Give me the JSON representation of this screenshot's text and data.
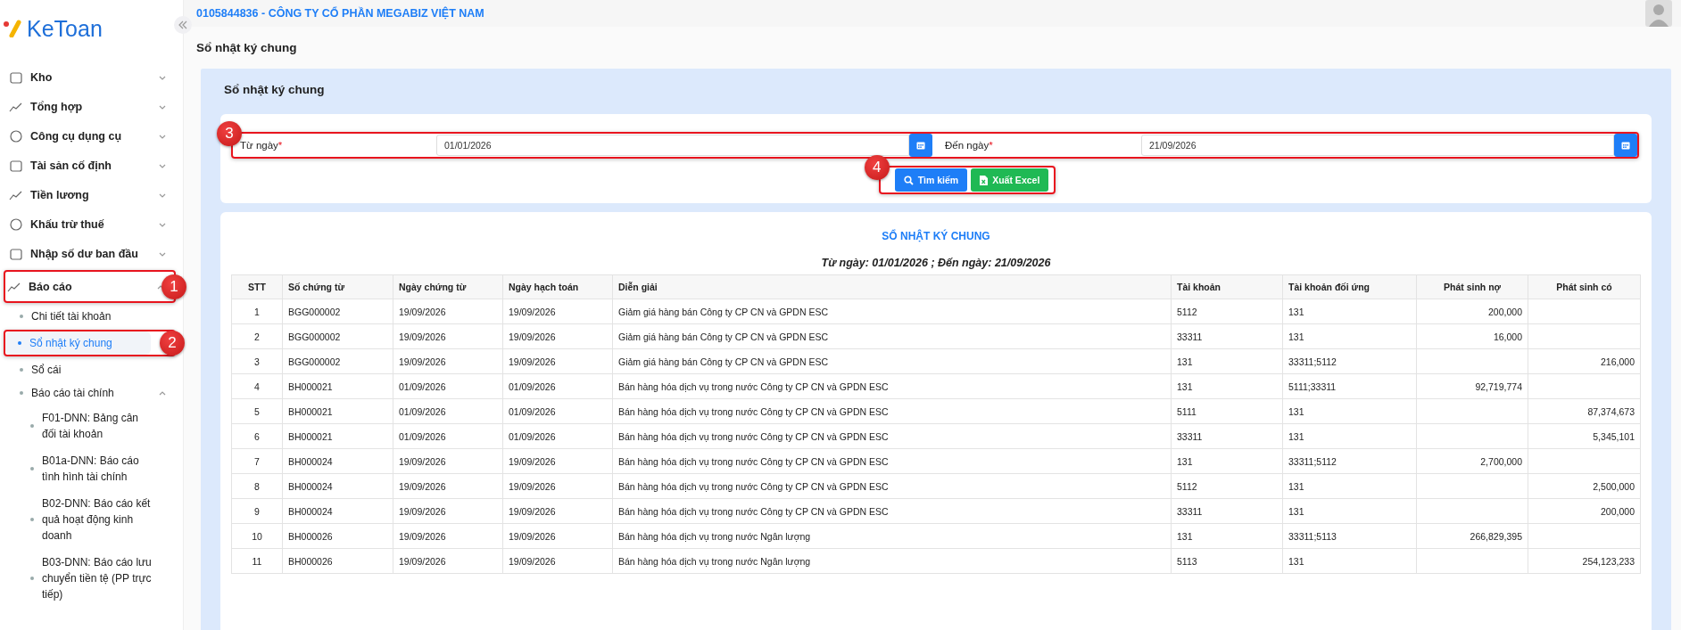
{
  "logo": {
    "text": "KeToan"
  },
  "sidebar": {
    "items": [
      {
        "label": "Kho",
        "expanded": false,
        "selected": false
      },
      {
        "label": "Tổng hợp",
        "expanded": false,
        "selected": false
      },
      {
        "label": "Công cụ dụng cụ",
        "expanded": false,
        "selected": false
      },
      {
        "label": "Tài sản cố định",
        "expanded": false,
        "selected": false
      },
      {
        "label": "Tiền lương",
        "expanded": false,
        "selected": false
      },
      {
        "label": "Khấu trừ thuế",
        "expanded": false,
        "selected": false
      },
      {
        "label": "Nhập số dư ban đầu",
        "expanded": false,
        "selected": false
      },
      {
        "label": "Báo cáo",
        "expanded": true,
        "selected": false,
        "callout": "1",
        "children": [
          {
            "label": "Chi tiết tài khoản",
            "selected": false
          },
          {
            "label": "Sổ nhật ký chung",
            "selected": true,
            "callout": "2"
          },
          {
            "label": "Sổ cái",
            "selected": false
          },
          {
            "label": "Báo cáo tài chính",
            "selected": false,
            "expanded": true,
            "children": [
              {
                "label": "F01-DNN: Bảng cân đối tài khoản",
                "selected": false
              },
              {
                "label": "B01a-DNN: Báo cáo tình hình tài chính",
                "selected": false
              },
              {
                "label": "B02-DNN: Báo cáo kết quả hoạt động kinh doanh",
                "selected": false
              },
              {
                "label": "B03-DNN: Báo cáo lưu chuyển tiền tệ (PP trực tiếp)",
                "selected": false
              }
            ]
          }
        ]
      }
    ]
  },
  "header": {
    "company": "0105844836 - CÔNG TY CỔ PHẦN MEGABIZ VIỆT NAM"
  },
  "page_title": "Sổ nhật ký chung",
  "panel_title": "Sổ nhật ký chung",
  "filters": {
    "callout": "3",
    "fields": [
      {
        "label": "Từ ngày",
        "required_mark": "*",
        "value": "01/01/2026"
      },
      {
        "label": "Đến ngày",
        "required_mark": "*",
        "value": "21/09/2026"
      }
    ]
  },
  "actions": {
    "callout": "4",
    "buttons": [
      {
        "label": "Tìm kiếm",
        "kind": "search"
      },
      {
        "label": "Xuất Excel",
        "kind": "excel"
      }
    ]
  },
  "report": {
    "title": "SỔ NHẬT KÝ CHUNG",
    "subtitle": "Từ ngày: 01/01/2026 ;  Đến ngày: 21/09/2026"
  },
  "table": {
    "columns": [
      "STT",
      "Số chứng từ",
      "Ngày chứng từ",
      "Ngày hạch toán",
      "Diễn giải",
      "Tài khoản",
      "Tài khoản đối ứng",
      "Phát sinh nợ",
      "Phát sinh có"
    ],
    "rows": [
      [
        "1",
        "BGG000002",
        "19/09/2026",
        "19/09/2026",
        "Giảm giá hàng bán Công ty CP CN và GPDN ESC",
        "5112",
        "131",
        "200,000",
        ""
      ],
      [
        "2",
        "BGG000002",
        "19/09/2026",
        "19/09/2026",
        "Giảm giá hàng bán Công ty CP CN và GPDN ESC",
        "33311",
        "131",
        "16,000",
        ""
      ],
      [
        "3",
        "BGG000002",
        "19/09/2026",
        "19/09/2026",
        "Giảm giá hàng bán Công ty CP CN và GPDN ESC",
        "131",
        "33311;5112",
        "",
        "216,000"
      ],
      [
        "4",
        "BH000021",
        "01/09/2026",
        "01/09/2026",
        "Bán hàng hóa dịch vụ trong nước Công ty CP CN và GPDN ESC",
        "131",
        "5111;33311",
        "92,719,774",
        ""
      ],
      [
        "5",
        "BH000021",
        "01/09/2026",
        "01/09/2026",
        "Bán hàng hóa dịch vụ trong nước Công ty CP CN và GPDN ESC",
        "5111",
        "131",
        "",
        "87,374,673"
      ],
      [
        "6",
        "BH000021",
        "01/09/2026",
        "01/09/2026",
        "Bán hàng hóa dịch vụ trong nước Công ty CP CN và GPDN ESC",
        "33311",
        "131",
        "",
        "5,345,101"
      ],
      [
        "7",
        "BH000024",
        "19/09/2026",
        "19/09/2026",
        "Bán hàng hóa dịch vụ trong nước Công ty CP CN và GPDN ESC",
        "131",
        "33311;5112",
        "2,700,000",
        ""
      ],
      [
        "8",
        "BH000024",
        "19/09/2026",
        "19/09/2026",
        "Bán hàng hóa dịch vụ trong nước Công ty CP CN và GPDN ESC",
        "5112",
        "131",
        "",
        "2,500,000"
      ],
      [
        "9",
        "BH000024",
        "19/09/2026",
        "19/09/2026",
        "Bán hàng hóa dịch vụ trong nước Công ty CP CN và GPDN ESC",
        "33311",
        "131",
        "",
        "200,000"
      ],
      [
        "10",
        "BH000026",
        "19/09/2026",
        "19/09/2026",
        "Bán hàng hóa dịch vụ trong nước Ngân lượng",
        "131",
        "33311;5113",
        "266,829,395",
        ""
      ],
      [
        "11",
        "BH000026",
        "19/09/2026",
        "19/09/2026",
        "Bán hàng hóa dịch vụ trong nước Ngân lượng",
        "5113",
        "131",
        "",
        "254,123,233"
      ]
    ]
  }
}
